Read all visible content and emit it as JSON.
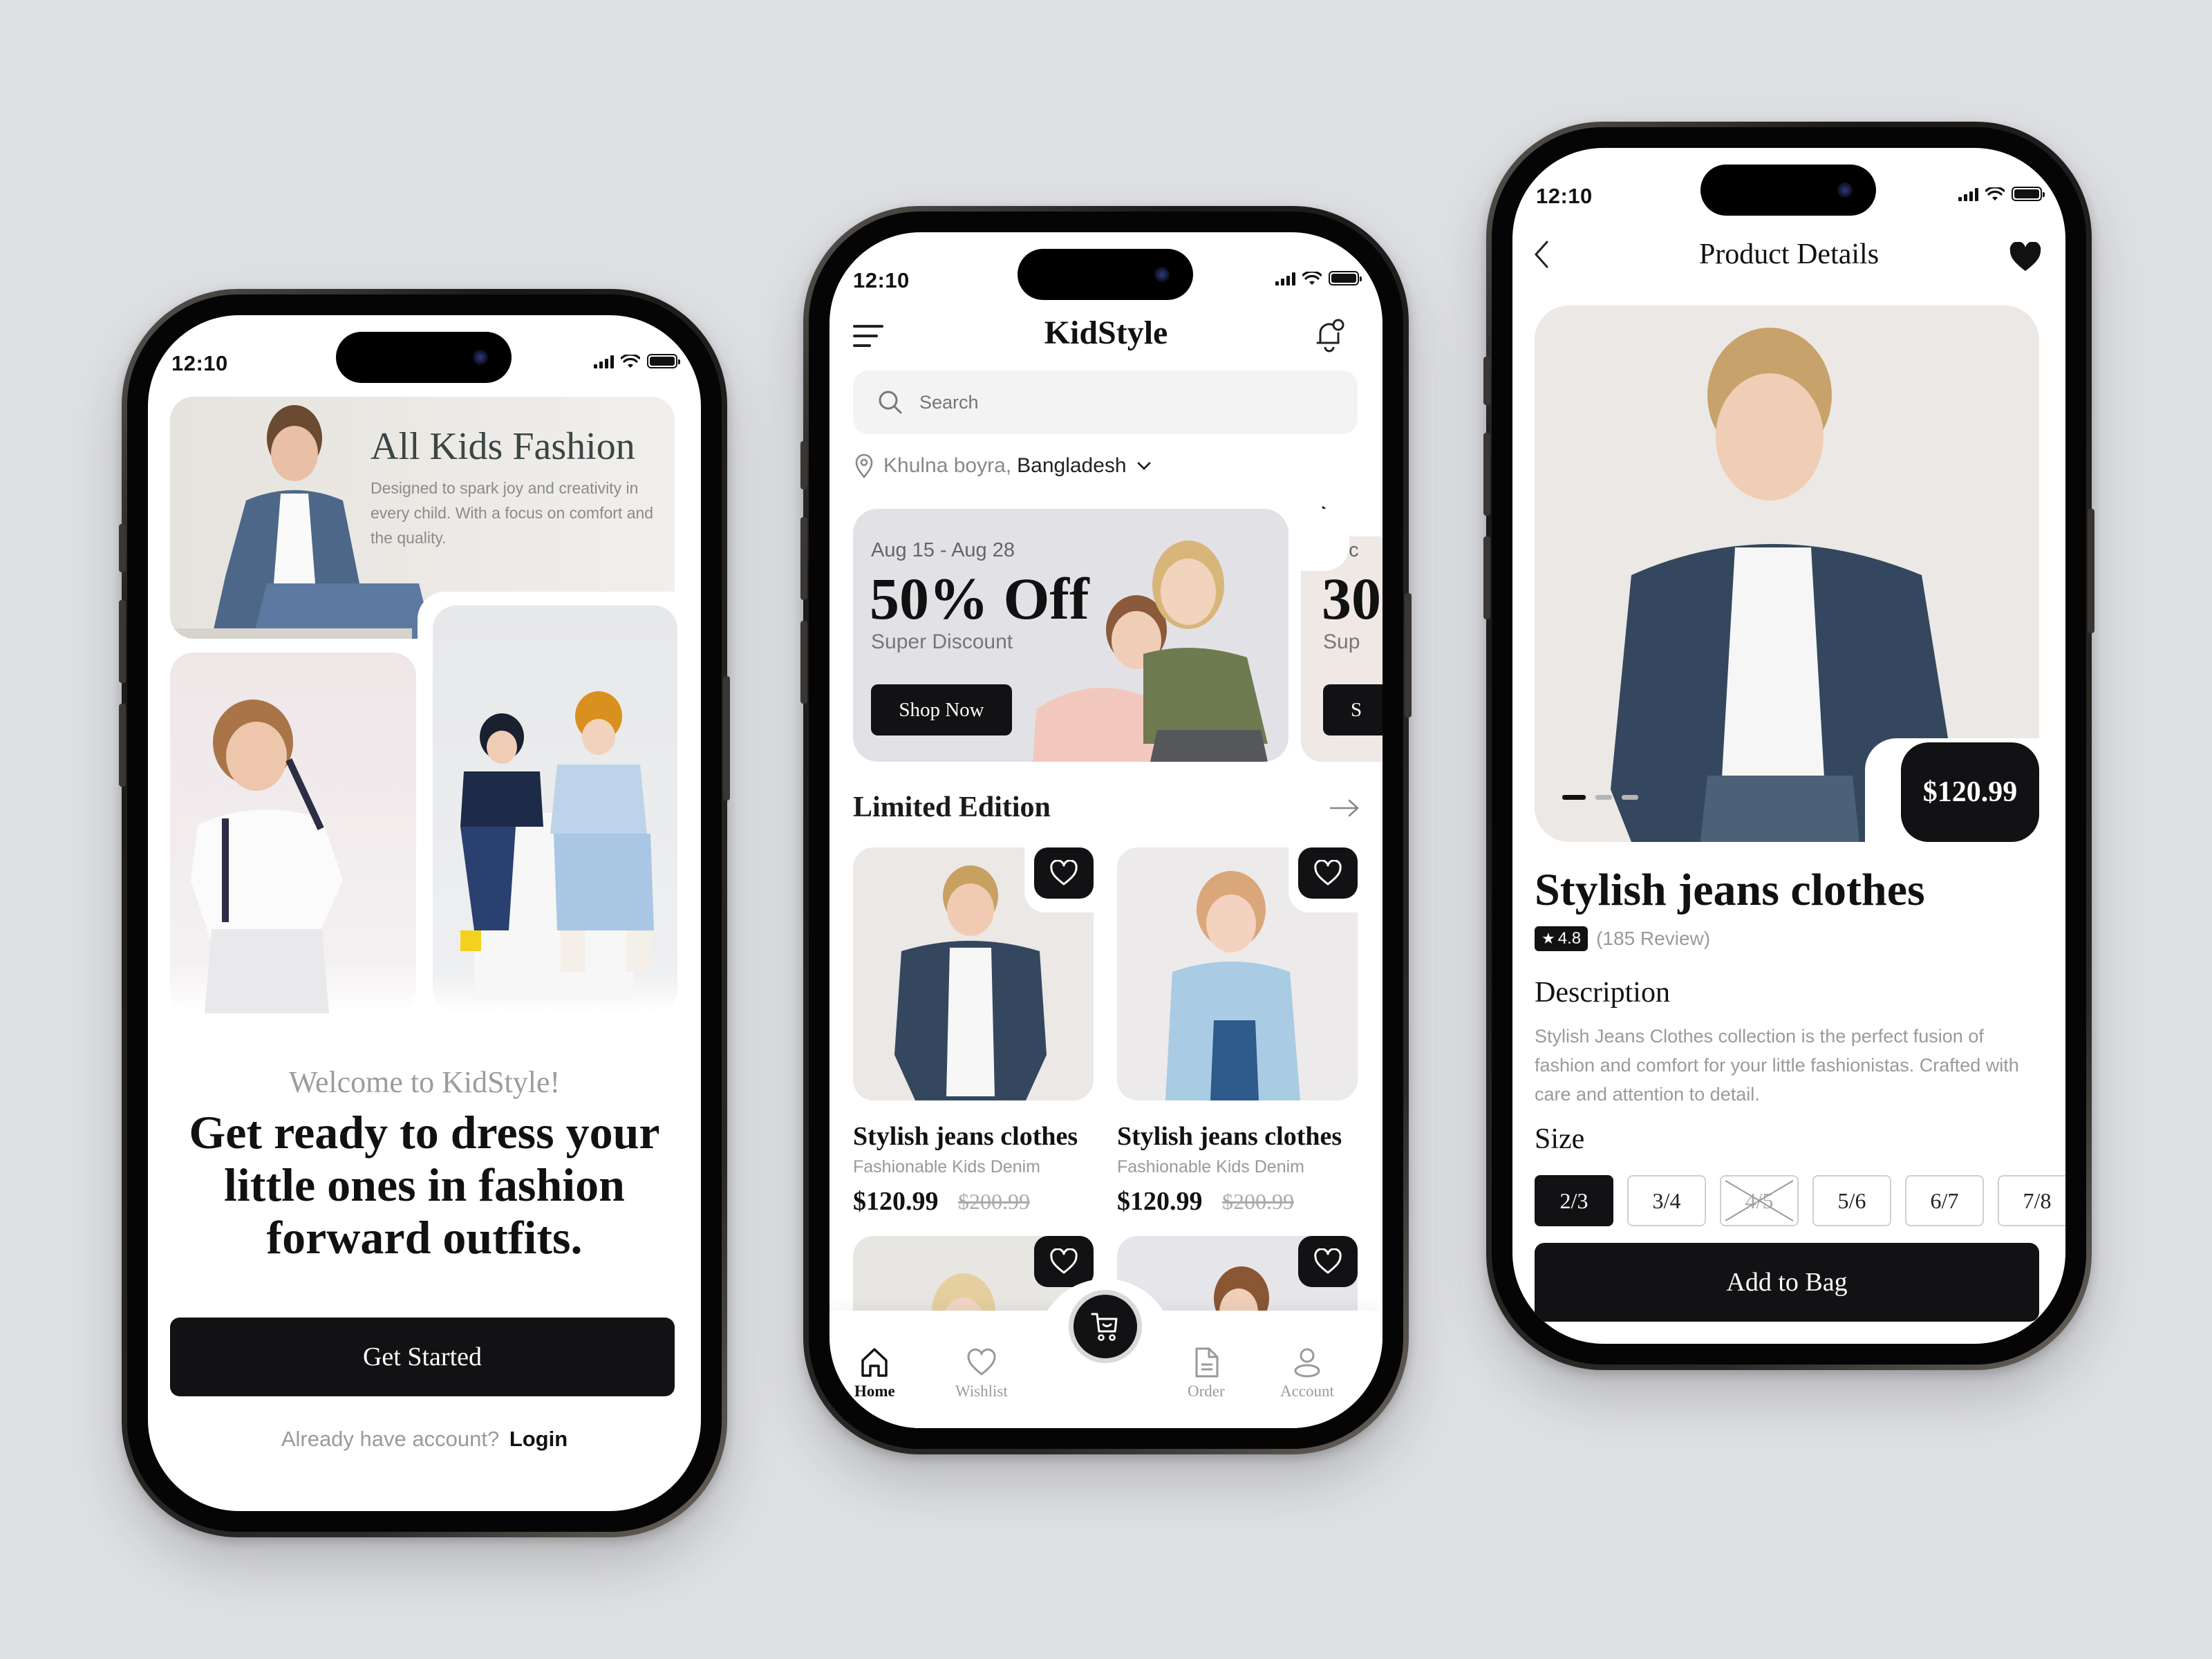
{
  "colors": {
    "background": "#dfe0e4",
    "primary_dark": "#121214",
    "muted_text": "#8b8b8b"
  },
  "status_bar": {
    "time": "12:10",
    "icons": [
      "signal-icon",
      "wifi-icon",
      "battery-icon"
    ]
  },
  "onboarding": {
    "hero_title": "All Kids Fashion",
    "hero_description": "Designed to spark joy and creativity in every child. With a focus on comfort and the quality.",
    "welcome": "Welcome to KidStyle!",
    "headline": "Get ready to dress your little ones in fashion forward outfits.",
    "get_started_label": "Get Started",
    "login_prompt": "Already have account?",
    "login_label": "Login"
  },
  "home": {
    "app_title": "KidStyle",
    "search_placeholder": "Search",
    "location_city": "Khulna boyra,",
    "location_country": "Bangladesh",
    "promos": [
      {
        "dates": "Aug 15 - Aug 28",
        "title": "50% Off",
        "subtitle": "Super Discount",
        "cta": "Shop Now"
      },
      {
        "dates": "Dec",
        "title": "30",
        "subtitle": "Sup",
        "cta": "S"
      }
    ],
    "section_title": "Limited Edition",
    "products": [
      {
        "name": "Stylish jeans clothes",
        "subtitle": "Fashionable Kids Denim",
        "price": "$120.99",
        "old_price": "$200.99"
      },
      {
        "name": "Stylish jeans clothes",
        "subtitle": "Fashionable Kids Denim",
        "price": "$120.99",
        "old_price": "$200.99"
      }
    ],
    "nav": [
      {
        "label": "Home",
        "icon": "home-icon",
        "active": true
      },
      {
        "label": "Wishlist",
        "icon": "heart-icon",
        "active": false
      },
      {
        "label": "Cart",
        "icon": "cart-icon",
        "active": false
      },
      {
        "label": "Order",
        "icon": "document-icon",
        "active": false
      },
      {
        "label": "Account",
        "icon": "user-icon",
        "active": false
      }
    ]
  },
  "details": {
    "title": "Product Details",
    "price": "$120.99",
    "carousel": {
      "current": 1,
      "total": 3
    },
    "product_name": "Stylish jeans clothes",
    "rating": "4.8",
    "reviews": "(185 Review)",
    "description_title": "Description",
    "description": "Stylish Jeans Clothes collection is the perfect fusion of fashion and comfort for your little fashionistas. Crafted with care and attention to detail.",
    "size_title": "Size",
    "sizes": [
      {
        "label": "2/3",
        "state": "selected"
      },
      {
        "label": "3/4",
        "state": "available"
      },
      {
        "label": "4/5",
        "state": "unavailable"
      },
      {
        "label": "5/6",
        "state": "available"
      },
      {
        "label": "6/7",
        "state": "available"
      },
      {
        "label": "7/8",
        "state": "available"
      }
    ],
    "add_to_bag_label": "Add to Bag"
  }
}
